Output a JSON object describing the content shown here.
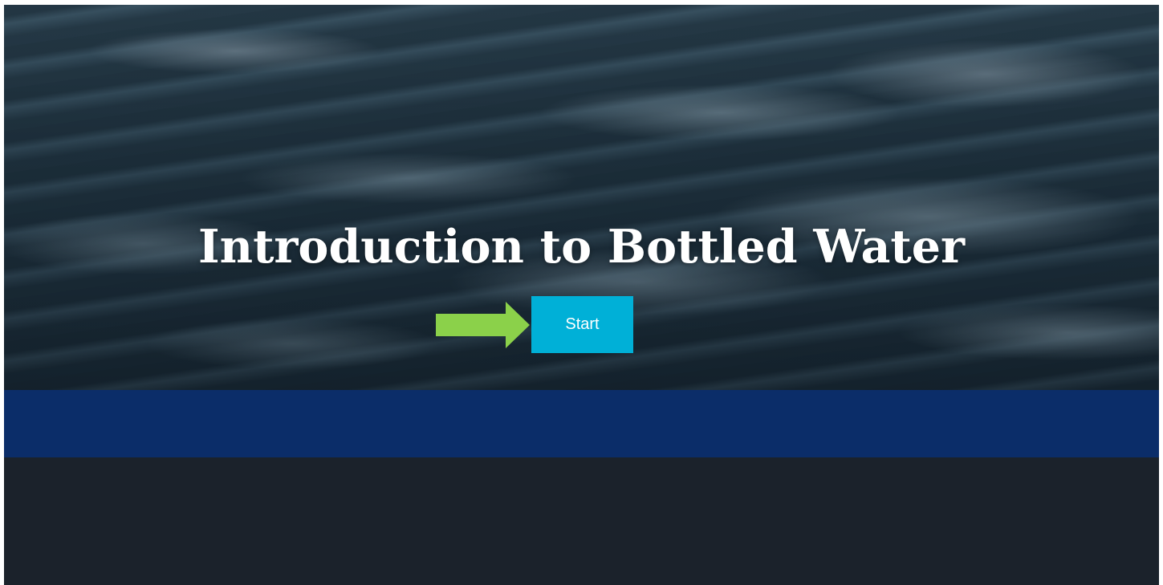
{
  "hero": {
    "title": "Introduction to Bottled Water",
    "start_label": "Start"
  },
  "icons": {
    "pointer_arrow": "arrow-right-icon"
  },
  "colors": {
    "start_button": "#00b0d7",
    "arrow": "#8bd14a",
    "blue_band": "#0b2d69",
    "footer": "#1b222b"
  }
}
